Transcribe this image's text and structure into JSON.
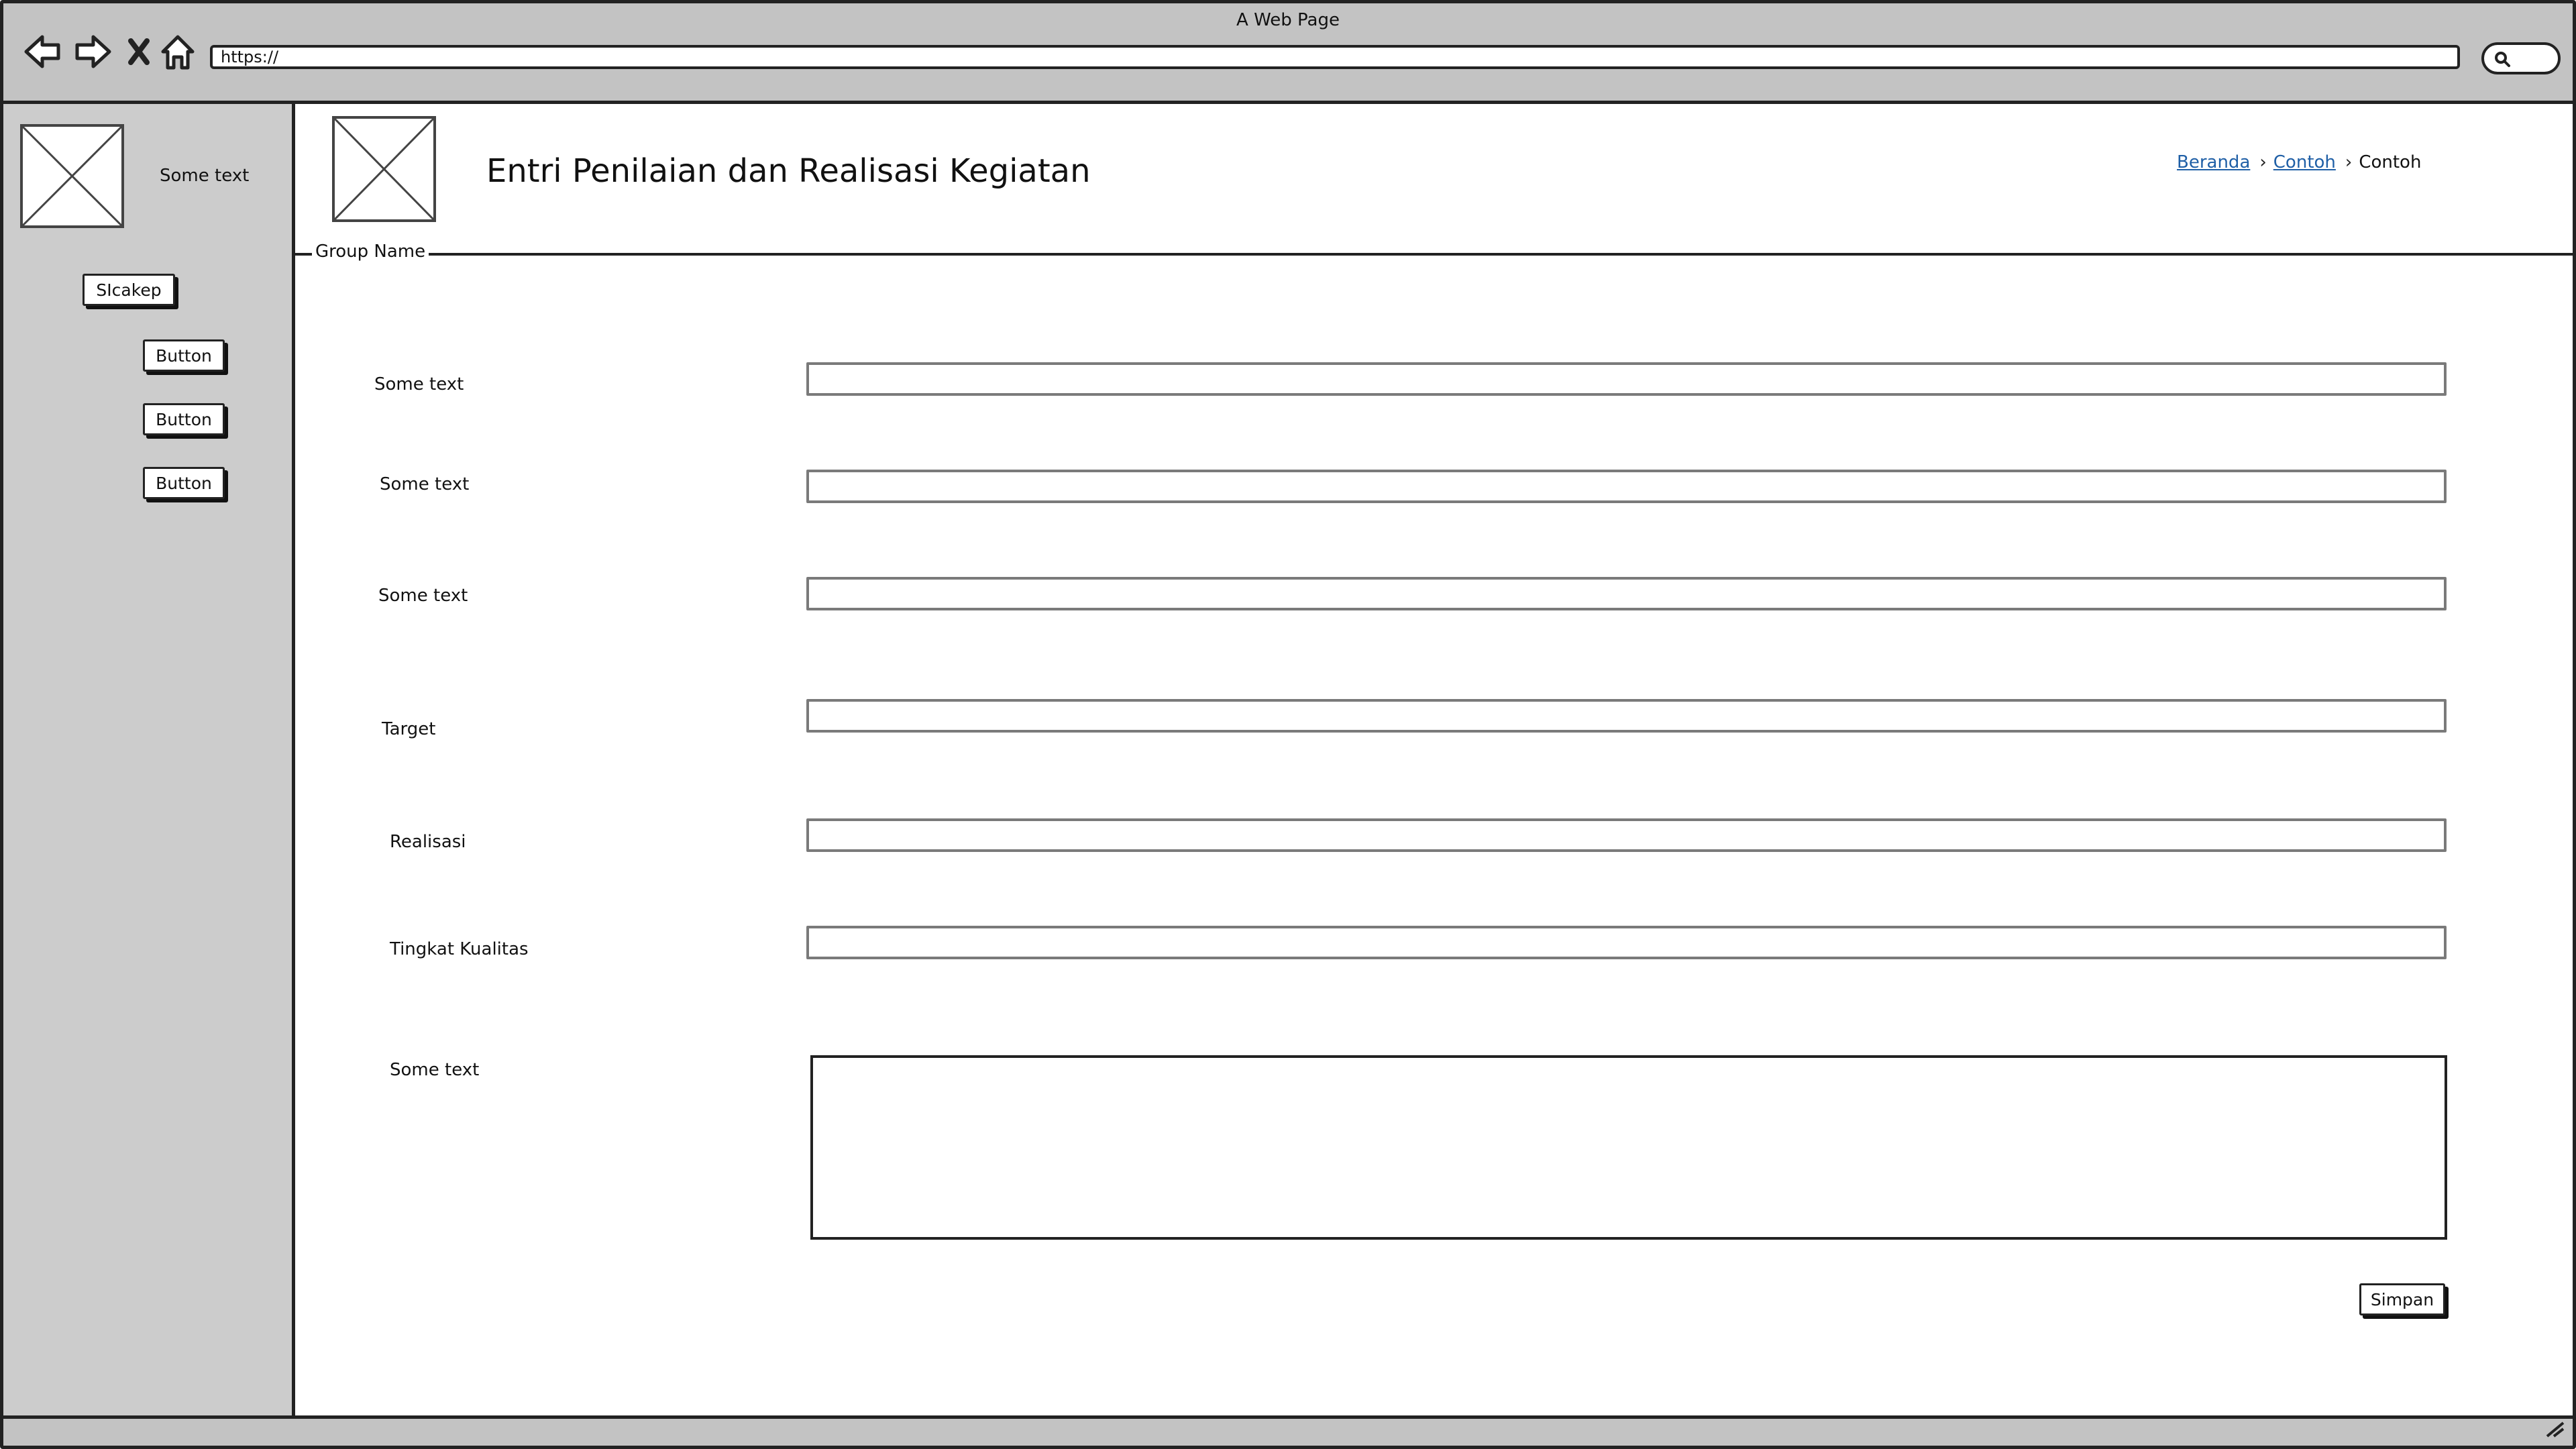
{
  "window": {
    "title": "A Web Page"
  },
  "browser": {
    "url": "https://",
    "icons": [
      "back-arrow-icon",
      "forward-arrow-icon",
      "stop-icon",
      "home-icon",
      "search-icon"
    ]
  },
  "sidebar": {
    "caption": "Some text",
    "app_button_label": "SIcakep",
    "buttons": [
      "Button",
      "Button",
      "Button"
    ]
  },
  "header": {
    "title": "Entri Penilaian dan Realisasi Kegiatan",
    "breadcrumb": [
      {
        "label": "Beranda",
        "link": true
      },
      {
        "label": "Contoh",
        "link": true
      },
      {
        "label": "Contoh",
        "link": false
      }
    ]
  },
  "form": {
    "group_name": "Group Name",
    "fields": [
      {
        "label": "Some text",
        "value": ""
      },
      {
        "label": "Some text",
        "value": ""
      },
      {
        "label": "Some text",
        "value": ""
      },
      {
        "label": "Target",
        "value": ""
      },
      {
        "label": "Realisasi",
        "value": ""
      },
      {
        "label": "Tingkat Kualitas",
        "value": ""
      }
    ],
    "notes": {
      "label": "Some text",
      "value": ""
    },
    "submit_label": "Simpan"
  }
}
